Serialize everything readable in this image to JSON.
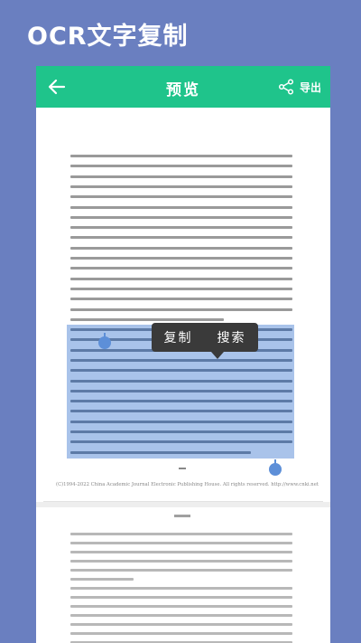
{
  "headline": "OCR文字复制",
  "topbar": {
    "title": "预览",
    "export_label": "导出"
  },
  "popup": {
    "copy_label": "复制",
    "search_label": "搜索"
  },
  "document": {
    "page_number_mark": "-",
    "copyright": "(C)1994-2022 China Academic Journal Electronic Publishing House. All rights reserved.    http://www.cnki.net"
  },
  "colors": {
    "background": "#6a7fc0",
    "topbar": "#1fc48b",
    "highlight": "#a9c3ea",
    "selection_handle": "#5d8fd8",
    "popup": "#3a3a3a"
  },
  "icons": {
    "back": "arrow-left-icon",
    "export": "share-icon"
  }
}
